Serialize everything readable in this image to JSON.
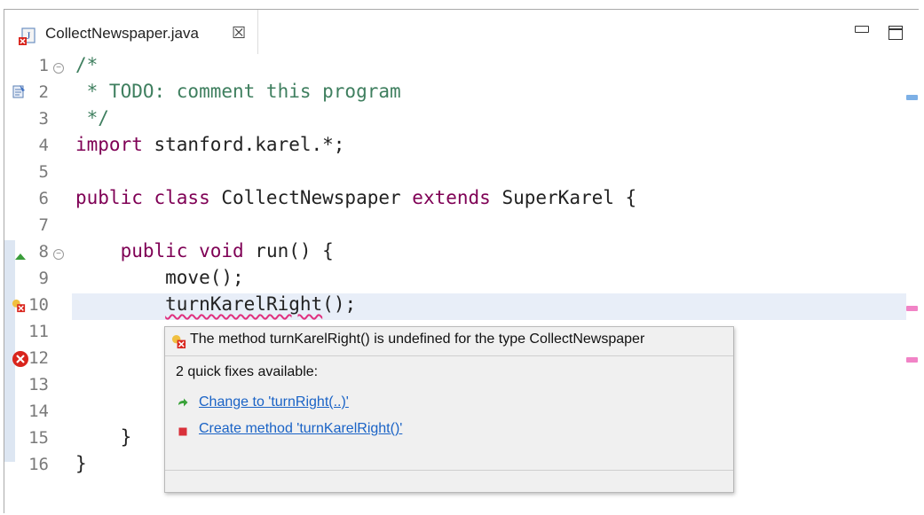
{
  "editor": {
    "tab_title": "CollectNewspaper.java",
    "tab_close_symbol": "☒",
    "lines": [
      {
        "num": "1",
        "text": "/*"
      },
      {
        "num": "2",
        "text": " * TODO: comment this program"
      },
      {
        "num": "3",
        "text": " */"
      },
      {
        "num": "4",
        "kw": "import",
        "rest": " stanford.karel.*;"
      },
      {
        "num": "5",
        "text": ""
      },
      {
        "num": "6",
        "kw": "public class",
        "mid": " CollectNewspaper ",
        "kw2": "extends",
        "rest": " SuperKarel {"
      },
      {
        "num": "7",
        "text": ""
      },
      {
        "num": "8",
        "indent": "    ",
        "kw": "public void",
        "rest": " run() {"
      },
      {
        "num": "9",
        "text": "        move();"
      },
      {
        "num": "10",
        "indent": "        ",
        "err": "turnKarelRight",
        "rest": "();"
      },
      {
        "num": "11",
        "text": ""
      },
      {
        "num": "12",
        "text": ""
      },
      {
        "num": "13",
        "text": ""
      },
      {
        "num": "14",
        "text": ""
      },
      {
        "num": "15",
        "text": "    }"
      },
      {
        "num": "16",
        "text": "}"
      }
    ]
  },
  "popup": {
    "message": "The method turnKarelRight() is undefined for the type CollectNewspaper",
    "subtitle": "2 quick fixes available:",
    "fixes": [
      {
        "label": "Change to 'turnRight(..)'",
        "icon": "change-arrow-icon"
      },
      {
        "label": "Create method 'turnKarelRight()'",
        "icon": "create-method-icon"
      }
    ]
  },
  "colors": {
    "comment": "#3f7f5f",
    "keyword": "#7f0055",
    "link": "#1a63c6",
    "error_underline": "#e0307f"
  }
}
